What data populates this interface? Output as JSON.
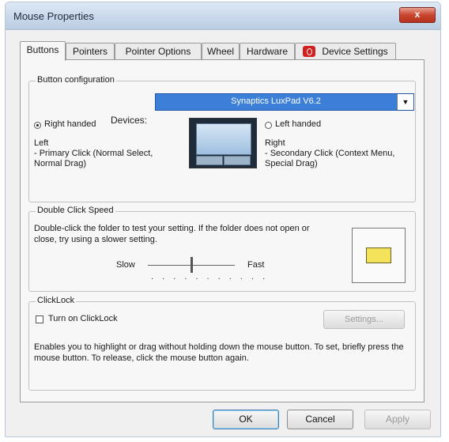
{
  "window": {
    "title": "Mouse Properties",
    "close_glyph": "x"
  },
  "tabs": [
    {
      "label": "Buttons",
      "active": true
    },
    {
      "label": "Pointers",
      "active": false
    },
    {
      "label": "Pointer Options",
      "active": false
    },
    {
      "label": "Wheel",
      "active": false
    },
    {
      "label": "Hardware",
      "active": false
    },
    {
      "label": "Device Settings",
      "active": false,
      "icon": "synaptics-device-icon"
    }
  ],
  "button_configuration": {
    "group_label": "Button configuration",
    "devices_label": "Devices:",
    "devices_value": "Synaptics LuxPad V6.2",
    "right_handed_label": "Right handed",
    "left_handed_label": "Left handed",
    "selected": "right_handed",
    "left_heading": "Left",
    "left_text": "- Primary Click (Normal Select, Normal Drag)",
    "right_heading": "Right",
    "right_text": "- Secondary Click (Context Menu, Special Drag)"
  },
  "double_click": {
    "group_label": "Double Click Speed",
    "description": "Double-click the folder to test your setting.  If the folder does not open or close, try using a slower setting.",
    "slow_label": "Slow",
    "fast_label": "Fast",
    "speed_fraction": 0.5,
    "ticks": ". . . . . . . . . . .",
    "folder_icon": "folder-icon"
  },
  "clicklock": {
    "group_label": "ClickLock",
    "checkbox_label": "Turn on ClickLock",
    "checked": false,
    "settings_button": "Settings...",
    "description": "Enables you to highlight or drag without holding down the mouse button.  To set, briefly press the mouse button.  To release, click the mouse button again."
  },
  "footer": {
    "ok": "OK",
    "cancel": "Cancel",
    "apply": "Apply"
  },
  "colors": {
    "selection_blue": "#3b7fd8",
    "close_red": "#c9452f"
  }
}
